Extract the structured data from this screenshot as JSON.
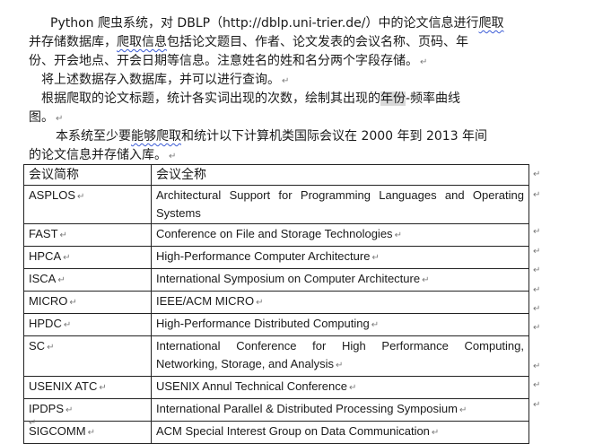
{
  "paragraphs": {
    "p1": {
      "line1": [
        "Python 爬虫系统，对 DBLP（http://dblp.uni-trier.de/）中的论文信息进行",
        "爬取"
      ],
      "line2": [
        "并存储数据库，",
        "爬取信息",
        "包括论文题目、作者、论文发表的会议名称、页码、年"
      ],
      "line3": "份、开会地点、开会日期等信息。注意姓名的姓和名分两个字段存储。"
    },
    "p2": "将上述数据存入数据库，并可以进行查询。",
    "p3": {
      "line1": [
        "根据爬取的论文标题，统计各实词出现的次数，绘制其出现的",
        "年份",
        "-频率曲线"
      ],
      "line2": "图。"
    },
    "p4": {
      "line1": [
        "本系统至少要",
        "能够爬取",
        "和统计以下计算机类国际会议在 2000 年到 2013 年间"
      ],
      "line2": "的论文信息并存储入库。"
    }
  },
  "paragraph_mark": "↵",
  "table": {
    "header": {
      "abbr": "会议简称",
      "full": "会议全称"
    },
    "rows": [
      {
        "abbr": "ASPLOS",
        "full": "Architectural Support for Programming Languages and Operating Systems"
      },
      {
        "abbr": "FAST",
        "full": "Conference on File and Storage Technologies"
      },
      {
        "abbr": "HPCA",
        "full": "High-Performance Computer Architecture"
      },
      {
        "abbr": "ISCA",
        "full": "International Symposium on Computer Architecture"
      },
      {
        "abbr": "MICRO",
        "full": "IEEE/ACM MICRO"
      },
      {
        "abbr": "HPDC",
        "full": "High-Performance Distributed Computing"
      },
      {
        "abbr": "SC",
        "full": "International Conference for High Performance Computing, Networking, Storage, and Analysis"
      },
      {
        "abbr": "USENIX ATC",
        "full": "USENIX Annul Technical Conference"
      },
      {
        "abbr": "IPDPS",
        "full": "International Parallel & Distributed Processing Symposium"
      },
      {
        "abbr": "SIGCOMM",
        "full": "ACM Special Interest Group on Data Communication"
      }
    ]
  }
}
